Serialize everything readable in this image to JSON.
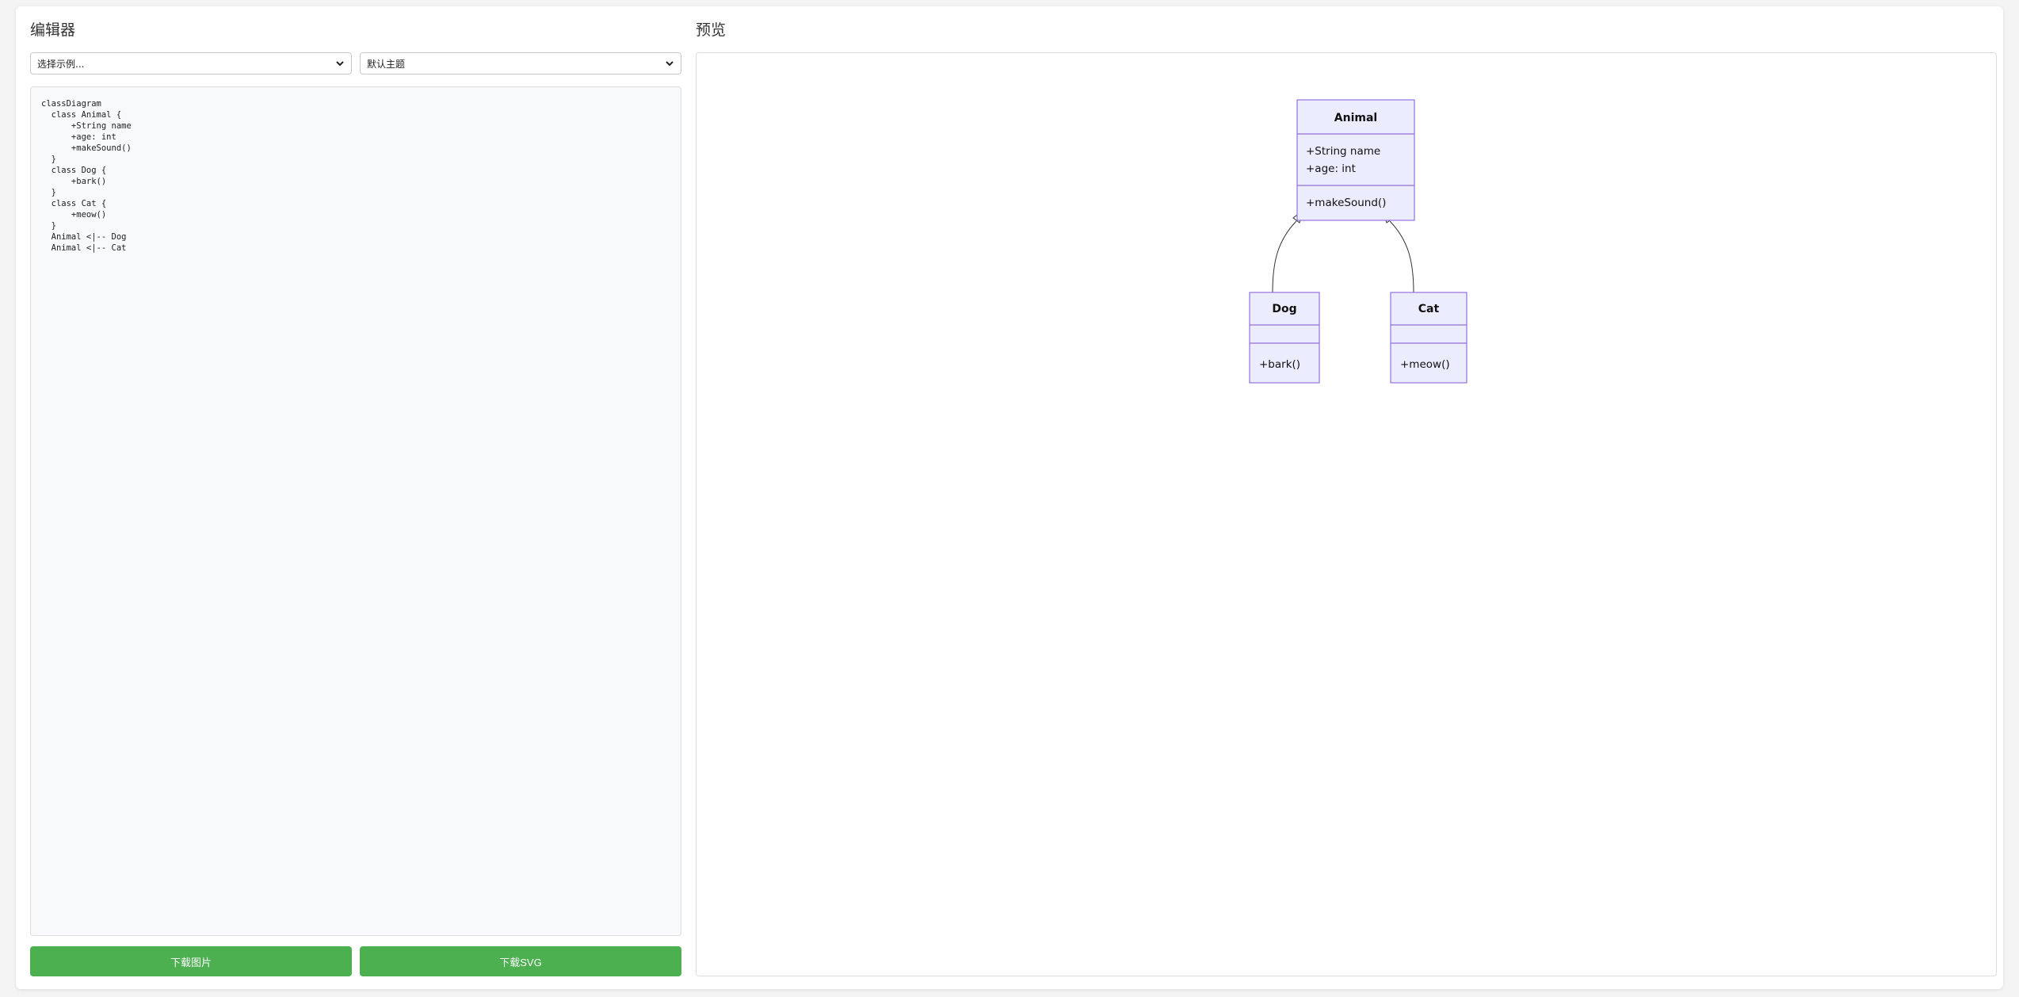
{
  "editor": {
    "title": "编辑器",
    "example_select": {
      "selected": "选择示例..."
    },
    "theme_select": {
      "selected": "默认主题"
    },
    "code": "classDiagram\n  class Animal {\n      +String name\n      +age: int\n      +makeSound()\n  }\n  class Dog {\n      +bark()\n  }\n  class Cat {\n      +meow()\n  }\n  Animal <|-- Dog\n  Animal <|-- Cat",
    "download_image_label": "下载图片",
    "download_svg_label": "下载SVG"
  },
  "preview": {
    "title": "预览",
    "diagram": {
      "type": "classDiagram",
      "classes": [
        {
          "name": "Animal",
          "attributes": [
            "+String name",
            "+age: int"
          ],
          "methods": [
            "+makeSound()"
          ]
        },
        {
          "name": "Dog",
          "attributes": [],
          "methods": [
            "+bark()"
          ]
        },
        {
          "name": "Cat",
          "attributes": [],
          "methods": [
            "+meow()"
          ]
        }
      ],
      "relations": [
        {
          "from": "Dog",
          "to": "Animal",
          "kind": "inheritance"
        },
        {
          "from": "Cat",
          "to": "Animal",
          "kind": "inheritance"
        }
      ],
      "colors": {
        "fill": "#ECECFF",
        "stroke": "#9370DB",
        "edge": "#333333"
      }
    }
  },
  "colors": {
    "accent_button": "#4caf50",
    "code_bg": "#f8f9fa"
  }
}
